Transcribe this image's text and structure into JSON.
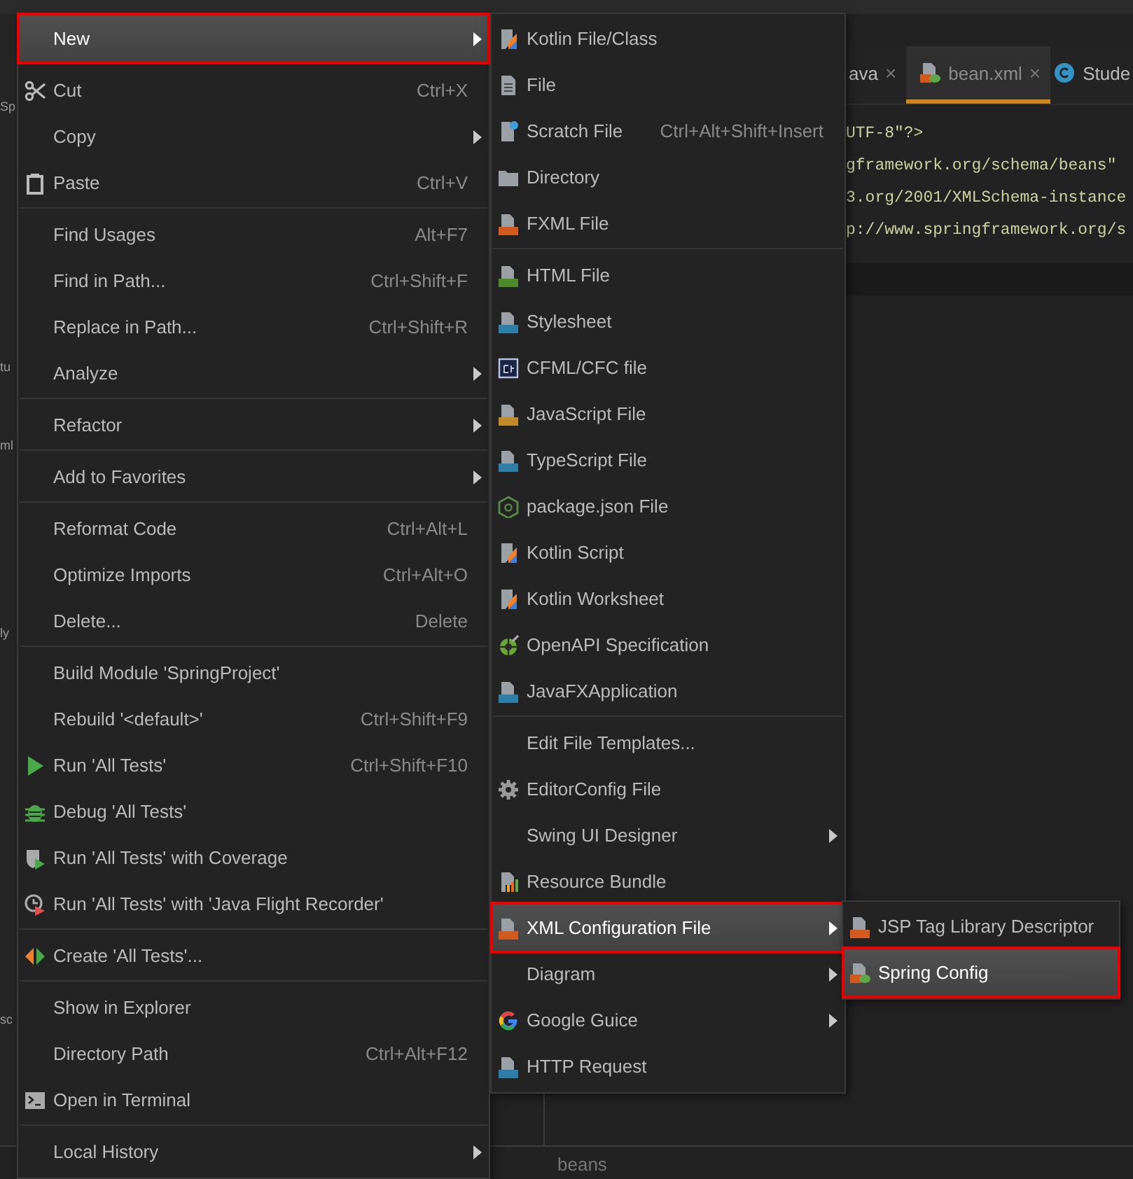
{
  "project_strip": {
    "fragments": [
      "Sp",
      "tu",
      "ml",
      "ly",
      "sc"
    ]
  },
  "editor": {
    "tabs": [
      {
        "label": "ava",
        "close": "×",
        "selected": false
      },
      {
        "label": "bean.xml",
        "close": "×",
        "selected": true
      },
      {
        "label": "Stude",
        "selected": false
      }
    ],
    "code_lines": [
      "UTF-8\"?>",
      "gframework.org/schema/beans\"",
      "3.org/2001/XMLSchema-instance",
      "p://www.springframework.org/s"
    ],
    "breadcrumb": "beans"
  },
  "context_menu": {
    "items": [
      {
        "kind": "item",
        "label": "New",
        "submenu": true,
        "selected": true,
        "annotated": true
      },
      {
        "kind": "separator"
      },
      {
        "kind": "item",
        "label": "Cut",
        "shortcut": "Ctrl+X",
        "selected": false
      },
      {
        "kind": "item",
        "label": "Copy",
        "submenu": true,
        "selected": false
      },
      {
        "kind": "item",
        "label": "Paste",
        "shortcut": "Ctrl+V",
        "selected": false
      },
      {
        "kind": "separator"
      },
      {
        "kind": "item",
        "label": "Find Usages",
        "shortcut": "Alt+F7",
        "selected": false
      },
      {
        "kind": "item",
        "label": "Find in Path...",
        "shortcut": "Ctrl+Shift+F",
        "selected": false
      },
      {
        "kind": "item",
        "label": "Replace in Path...",
        "shortcut": "Ctrl+Shift+R",
        "selected": false
      },
      {
        "kind": "item",
        "label": "Analyze",
        "submenu": true,
        "selected": false
      },
      {
        "kind": "separator"
      },
      {
        "kind": "item",
        "label": "Refactor",
        "submenu": true,
        "selected": false
      },
      {
        "kind": "separator"
      },
      {
        "kind": "item",
        "label": "Add to Favorites",
        "submenu": true,
        "selected": false
      },
      {
        "kind": "separator"
      },
      {
        "kind": "item",
        "label": "Reformat Code",
        "shortcut": "Ctrl+Alt+L",
        "selected": false
      },
      {
        "kind": "item",
        "label": "Optimize Imports",
        "shortcut": "Ctrl+Alt+O",
        "selected": false
      },
      {
        "kind": "item",
        "label": "Delete...",
        "shortcut": "Delete",
        "selected": false
      },
      {
        "kind": "separator"
      },
      {
        "kind": "item",
        "label": "Build Module 'SpringProject'",
        "selected": false
      },
      {
        "kind": "item",
        "label": "Rebuild '<default>'",
        "shortcut": "Ctrl+Shift+F9",
        "selected": false
      },
      {
        "kind": "item",
        "label": "Run 'All Tests'",
        "shortcut": "Ctrl+Shift+F10",
        "selected": false
      },
      {
        "kind": "item",
        "label": "Debug 'All Tests'",
        "selected": false
      },
      {
        "kind": "item",
        "label": "Run 'All Tests' with Coverage",
        "selected": false
      },
      {
        "kind": "item",
        "label": "Run 'All Tests' with 'Java Flight Recorder'",
        "selected": false
      },
      {
        "kind": "separator"
      },
      {
        "kind": "item",
        "label": "Create 'All Tests'...",
        "selected": false
      },
      {
        "kind": "separator"
      },
      {
        "kind": "item",
        "label": "Show in Explorer",
        "selected": false
      },
      {
        "kind": "item",
        "label": "Directory Path",
        "shortcut": "Ctrl+Alt+F12",
        "selected": false
      },
      {
        "kind": "item",
        "label": "Open in Terminal",
        "selected": false
      },
      {
        "kind": "separator"
      },
      {
        "kind": "item",
        "label": "Local History",
        "submenu": true,
        "selected": false
      }
    ]
  },
  "new_submenu": {
    "items": [
      {
        "kind": "item",
        "label": "Kotlin File/Class",
        "selected": false
      },
      {
        "kind": "item",
        "label": "File",
        "selected": false
      },
      {
        "kind": "item",
        "label": "Scratch File",
        "shortcut": "Ctrl+Alt+Shift+Insert",
        "selected": false
      },
      {
        "kind": "item",
        "label": "Directory",
        "selected": false
      },
      {
        "kind": "item",
        "label": "FXML File",
        "selected": false
      },
      {
        "kind": "separator"
      },
      {
        "kind": "item",
        "label": "HTML File",
        "selected": false
      },
      {
        "kind": "item",
        "label": "Stylesheet",
        "selected": false
      },
      {
        "kind": "item",
        "label": "CFML/CFC file",
        "selected": false
      },
      {
        "kind": "item",
        "label": "JavaScript File",
        "selected": false
      },
      {
        "kind": "item",
        "label": "TypeScript File",
        "selected": false
      },
      {
        "kind": "item",
        "label": "package.json File",
        "selected": false
      },
      {
        "kind": "item",
        "label": "Kotlin Script",
        "selected": false
      },
      {
        "kind": "item",
        "label": "Kotlin Worksheet",
        "selected": false
      },
      {
        "kind": "item",
        "label": "OpenAPI Specification",
        "selected": false
      },
      {
        "kind": "item",
        "label": "JavaFXApplication",
        "selected": false
      },
      {
        "kind": "separator"
      },
      {
        "kind": "item",
        "label": "Edit File Templates...",
        "selected": false
      },
      {
        "kind": "item",
        "label": "EditorConfig File",
        "selected": false
      },
      {
        "kind": "item",
        "label": "Swing UI Designer",
        "submenu": true,
        "selected": false
      },
      {
        "kind": "item",
        "label": "Resource Bundle",
        "selected": false
      },
      {
        "kind": "item",
        "label": "XML Configuration File",
        "submenu": true,
        "selected": true,
        "annotated": true
      },
      {
        "kind": "item",
        "label": "Diagram",
        "submenu": true,
        "selected": false
      },
      {
        "kind": "item",
        "label": "Google Guice",
        "submenu": true,
        "selected": false
      },
      {
        "kind": "item",
        "label": "HTTP Request",
        "selected": false
      }
    ]
  },
  "xml_submenu": {
    "items": [
      {
        "kind": "item",
        "label": "JSP Tag Library Descriptor",
        "selected": false
      },
      {
        "kind": "item",
        "label": "Spring Config",
        "selected": true,
        "annotated": true
      }
    ]
  }
}
